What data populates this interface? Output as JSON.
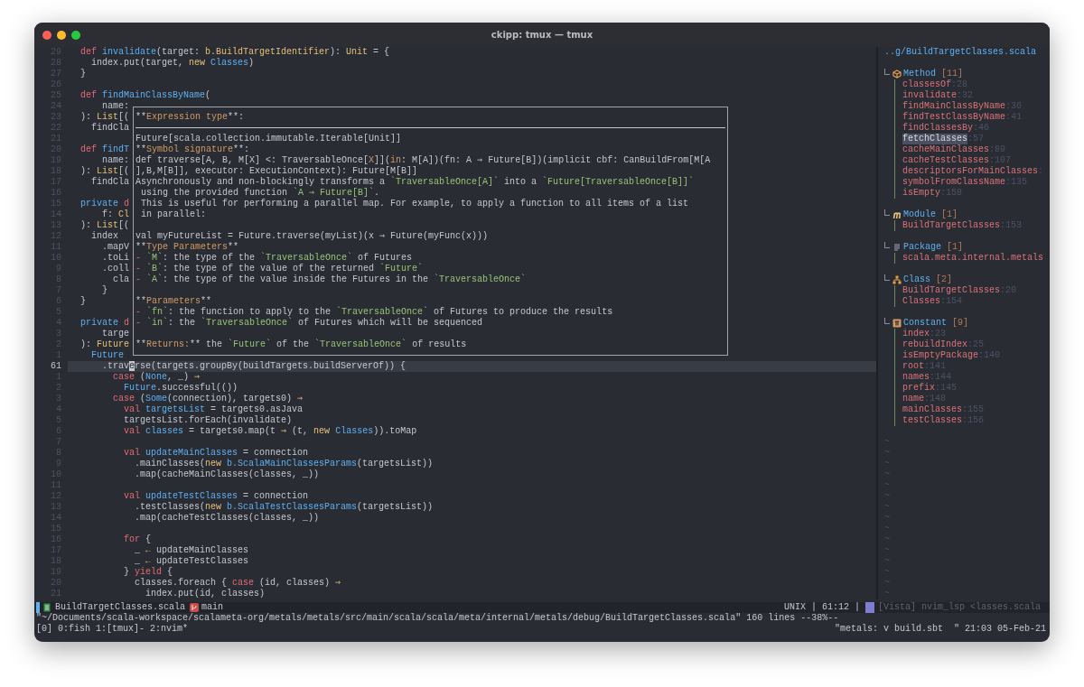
{
  "window": {
    "title": "ckipp: tmux — tmux"
  },
  "editor": {
    "lines": [
      {
        "num": "29",
        "current": false,
        "segs": [
          {
            "text": "def",
            "kind": "kw"
          },
          {
            "text": " invalidate",
            "kind": "fn"
          },
          {
            "text": "(target: ",
            "kind": "tx"
          },
          {
            "text": "b.BuildTargetIdentifier",
            "kind": "ty"
          },
          {
            "text": "): ",
            "kind": "tx"
          },
          {
            "text": "Unit",
            "kind": "ty"
          },
          {
            "text": " = {",
            "kind": "tx"
          }
        ]
      },
      {
        "num": "28",
        "current": false,
        "segs": [
          {
            "text": "  index.put(target, ",
            "kind": "tx"
          },
          {
            "text": "new",
            "kind": "ty"
          },
          {
            "text": " Classes",
            "kind": "fn"
          },
          {
            "text": ")",
            "kind": "tx"
          }
        ]
      },
      {
        "num": "27",
        "current": false,
        "segs": [
          {
            "text": "}",
            "kind": "tx"
          }
        ]
      },
      {
        "num": "26",
        "current": false
      },
      {
        "num": "25",
        "current": false,
        "segs": [
          {
            "text": "def",
            "kind": "kw"
          },
          {
            "text": " findMainClassByName",
            "kind": "fn"
          },
          {
            "text": "(",
            "kind": "tx"
          }
        ]
      },
      {
        "num": "24",
        "current": false,
        "segs": [
          {
            "text": "    name:",
            "kind": "tx"
          }
        ]
      },
      {
        "num": "23",
        "current": false,
        "segs": [
          {
            "text": "): ",
            "kind": "tx"
          },
          {
            "text": "List",
            "kind": "ty"
          },
          {
            "text": "[(",
            "kind": "tx"
          }
        ]
      },
      {
        "num": "22",
        "current": false,
        "segs": [
          {
            "text": "  findCla",
            "kind": "tx"
          }
        ]
      },
      {
        "num": "21",
        "current": false
      },
      {
        "num": "20",
        "current": false,
        "segs": [
          {
            "text": "def",
            "kind": "kw"
          },
          {
            "text": " findT",
            "kind": "fn"
          }
        ]
      },
      {
        "num": "19",
        "current": false,
        "segs": [
          {
            "text": "    name:",
            "kind": "tx"
          }
        ]
      },
      {
        "num": "18",
        "current": false,
        "segs": [
          {
            "text": "): ",
            "kind": "tx"
          },
          {
            "text": "List",
            "kind": "ty"
          },
          {
            "text": "[(",
            "kind": "tx"
          }
        ]
      },
      {
        "num": "17",
        "current": false,
        "segs": [
          {
            "text": "  findCla",
            "kind": "tx"
          }
        ]
      },
      {
        "num": "16",
        "current": false
      },
      {
        "num": "15",
        "current": false,
        "segs": [
          {
            "text": "private",
            "kind": "fn"
          },
          {
            "text": " d",
            "kind": "kw"
          }
        ]
      },
      {
        "num": "14",
        "current": false,
        "segs": [
          {
            "text": "    f: ",
            "kind": "tx"
          },
          {
            "text": "Cl",
            "kind": "ty"
          }
        ]
      },
      {
        "num": "13",
        "current": false,
        "segs": [
          {
            "text": "): ",
            "kind": "tx"
          },
          {
            "text": "List",
            "kind": "ty"
          },
          {
            "text": "[(",
            "kind": "tx"
          }
        ]
      },
      {
        "num": "12",
        "current": false,
        "segs": [
          {
            "text": "  index",
            "kind": "tx"
          }
        ]
      },
      {
        "num": "11",
        "current": false,
        "segs": [
          {
            "text": "    .mapV",
            "kind": "tx"
          }
        ]
      },
      {
        "num": "10",
        "current": false,
        "segs": [
          {
            "text": "    .toLi",
            "kind": "tx"
          }
        ]
      },
      {
        "num": "9",
        "current": false,
        "segs": [
          {
            "text": "    .coll",
            "kind": "tx"
          }
        ]
      },
      {
        "num": "8",
        "current": false,
        "segs": [
          {
            "text": "      cla",
            "kind": "tx"
          }
        ]
      },
      {
        "num": "7",
        "current": false,
        "segs": [
          {
            "text": "    }",
            "kind": "tx"
          }
        ]
      },
      {
        "num": "6",
        "current": false,
        "segs": [
          {
            "text": "}",
            "kind": "tx"
          }
        ]
      },
      {
        "num": "5",
        "current": false
      },
      {
        "num": "4",
        "current": false,
        "segs": [
          {
            "text": "private",
            "kind": "fn"
          },
          {
            "text": " d",
            "kind": "kw"
          }
        ]
      },
      {
        "num": "3",
        "current": false,
        "segs": [
          {
            "text": "    targe",
            "kind": "tx"
          }
        ]
      },
      {
        "num": "2",
        "current": false,
        "segs": [
          {
            "text": "): ",
            "kind": "tx"
          },
          {
            "text": "Future",
            "kind": "ty"
          }
        ]
      },
      {
        "num": "1",
        "current": false,
        "segs": [
          {
            "text": "  Future",
            "kind": "fn"
          }
        ]
      },
      {
        "num": "61",
        "current": true,
        "segs": [
          {
            "text": "    .trav",
            "kind": "tx"
          },
          {
            "text": "e",
            "kind": "cur"
          },
          {
            "text": "rse(targets.groupBy(buildTargets.buildServerOf)) {",
            "kind": "tx"
          }
        ]
      },
      {
        "num": "1",
        "current": false,
        "segs": [
          {
            "text": "      case",
            "kind": "kw"
          },
          {
            "text": " (",
            "kind": "tx"
          },
          {
            "text": "None",
            "kind": "fn"
          },
          {
            "text": ", _) ",
            "kind": "tx"
          },
          {
            "text": "⇒",
            "kind": "ty"
          }
        ]
      },
      {
        "num": "2",
        "current": false,
        "segs": [
          {
            "text": "        Future",
            "kind": "fn"
          },
          {
            "text": ".successful(())",
            "kind": "tx"
          }
        ]
      },
      {
        "num": "3",
        "current": false,
        "segs": [
          {
            "text": "      case",
            "kind": "kw"
          },
          {
            "text": " (",
            "kind": "tx"
          },
          {
            "text": "Some",
            "kind": "fn"
          },
          {
            "text": "(connection), targets0) ",
            "kind": "tx"
          },
          {
            "text": "⇒",
            "kind": "ty"
          }
        ]
      },
      {
        "num": "4",
        "current": false,
        "segs": [
          {
            "text": "        val",
            "kind": "kw"
          },
          {
            "text": " targetsList",
            "kind": "fn"
          },
          {
            "text": " = targets0.asJava",
            "kind": "tx"
          }
        ]
      },
      {
        "num": "5",
        "current": false,
        "segs": [
          {
            "text": "        targetsList.forEach(invalidate)",
            "kind": "tx"
          }
        ]
      },
      {
        "num": "6",
        "current": false,
        "segs": [
          {
            "text": "        val",
            "kind": "kw"
          },
          {
            "text": " classes",
            "kind": "fn"
          },
          {
            "text": " = targets0.map(t ",
            "kind": "tx"
          },
          {
            "text": "⇒",
            "kind": "ty"
          },
          {
            "text": " (t, ",
            "kind": "tx"
          },
          {
            "text": "new",
            "kind": "ty"
          },
          {
            "text": " Classes",
            "kind": "fn"
          },
          {
            "text": ")).toMap",
            "kind": "tx"
          }
        ]
      },
      {
        "num": "7",
        "current": false
      },
      {
        "num": "8",
        "current": false,
        "segs": [
          {
            "text": "        val",
            "kind": "kw"
          },
          {
            "text": " updateMainClasses",
            "kind": "fn"
          },
          {
            "text": " = connection",
            "kind": "tx"
          }
        ]
      },
      {
        "num": "9",
        "current": false,
        "segs": [
          {
            "text": "          .mainClasses(",
            "kind": "tx"
          },
          {
            "text": "new",
            "kind": "ty"
          },
          {
            "text": " b.ScalaMainClassesParams",
            "kind": "fn"
          },
          {
            "text": "(targetsList))",
            "kind": "tx"
          }
        ]
      },
      {
        "num": "10",
        "current": false,
        "segs": [
          {
            "text": "          .map(cacheMainClasses(classes, _))",
            "kind": "tx"
          }
        ]
      },
      {
        "num": "11",
        "current": false
      },
      {
        "num": "12",
        "current": false,
        "segs": [
          {
            "text": "        val",
            "kind": "kw"
          },
          {
            "text": " updateTestClasses",
            "kind": "fn"
          },
          {
            "text": " = connection",
            "kind": "tx"
          }
        ]
      },
      {
        "num": "13",
        "current": false,
        "segs": [
          {
            "text": "          .testClasses(",
            "kind": "tx"
          },
          {
            "text": "new",
            "kind": "ty"
          },
          {
            "text": " b.ScalaTestClassesParams",
            "kind": "fn"
          },
          {
            "text": "(targetsList))",
            "kind": "tx"
          }
        ]
      },
      {
        "num": "14",
        "current": false,
        "segs": [
          {
            "text": "          .map(cacheTestClasses(classes, _))",
            "kind": "tx"
          }
        ]
      },
      {
        "num": "15",
        "current": false
      },
      {
        "num": "16",
        "current": false,
        "segs": [
          {
            "text": "        for",
            "kind": "kw"
          },
          {
            "text": " {",
            "kind": "tx"
          }
        ]
      },
      {
        "num": "17",
        "current": false,
        "segs": [
          {
            "text": "          _ ",
            "kind": "tx"
          },
          {
            "text": "←",
            "kind": "ty"
          },
          {
            "text": " updateMainClasses",
            "kind": "tx"
          }
        ]
      },
      {
        "num": "18",
        "current": false,
        "segs": [
          {
            "text": "          _ ",
            "kind": "tx"
          },
          {
            "text": "←",
            "kind": "ty"
          },
          {
            "text": " updateTestClasses",
            "kind": "tx"
          }
        ]
      },
      {
        "num": "19",
        "current": false,
        "segs": [
          {
            "text": "        } ",
            "kind": "tx"
          },
          {
            "text": "yield",
            "kind": "kw"
          },
          {
            "text": " {",
            "kind": "tx"
          }
        ]
      },
      {
        "num": "20",
        "current": false,
        "segs": [
          {
            "text": "          classes.foreach { ",
            "kind": "tx"
          },
          {
            "text": "case",
            "kind": "kw"
          },
          {
            "text": " (id, classes) ",
            "kind": "tx"
          },
          {
            "text": "⇒",
            "kind": "ty"
          }
        ]
      },
      {
        "num": "21",
        "current": false,
        "segs": [
          {
            "text": "            index.put(id, classes)",
            "kind": "tx"
          }
        ]
      }
    ]
  },
  "hover_popup": {
    "lines": [
      {
        "kind": "text",
        "segs": [
          {
            "text": "**",
            "kind": "tx"
          },
          {
            "text": "Expression type",
            "kind": "md"
          },
          {
            "text": "**:",
            "kind": "tx"
          }
        ]
      },
      {
        "kind": "rule"
      },
      {
        "kind": "text",
        "segs": [
          {
            "text": "Future[scala.collection.immutable.Iterable[Unit]]",
            "kind": "tx"
          }
        ]
      },
      {
        "kind": "text",
        "segs": [
          {
            "text": "**",
            "kind": "tx"
          },
          {
            "text": "Symbol signature",
            "kind": "md"
          },
          {
            "text": "**:",
            "kind": "tx"
          }
        ]
      },
      {
        "kind": "text",
        "segs": [
          {
            "text": "def traverse[A, B, M[X] <: TraversableOnce[",
            "kind": "tx"
          },
          {
            "text": "X",
            "kind": "md"
          },
          {
            "text": "]](",
            "kind": "tx"
          },
          {
            "text": "in",
            "kind": "md"
          },
          {
            "text": ": M[A])(fn: A ⇒ Future[B])(implicit cbf: CanBuildFrom[M[A",
            "kind": "tx"
          }
        ]
      },
      {
        "kind": "text",
        "segs": [
          {
            "text": "],B,M[B]], executor: ExecutionContext): Future[M[B]]",
            "kind": "tx"
          }
        ]
      },
      {
        "kind": "text",
        "segs": [
          {
            "text": "Asynchronously and non-blockingly transforms a ",
            "kind": "tx"
          },
          {
            "text": "`TraversableOnce[A]`",
            "kind": "code"
          },
          {
            "text": " into a ",
            "kind": "tx"
          },
          {
            "text": "`Future[TraversableOnce[B]]`",
            "kind": "code"
          }
        ]
      },
      {
        "kind": "text",
        "segs": [
          {
            "text": " using the provided function ",
            "kind": "tx"
          },
          {
            "text": "`A ⇒ Future[B]`",
            "kind": "code"
          },
          {
            "text": ".",
            "kind": "tx"
          }
        ]
      },
      {
        "kind": "text",
        "segs": [
          {
            "text": " This is useful for performing a parallel map. For example, to apply a function to all items of a list",
            "kind": "tx"
          }
        ]
      },
      {
        "kind": "text",
        "segs": [
          {
            "text": " in parallel:",
            "kind": "tx"
          }
        ]
      },
      {
        "kind": "blank"
      },
      {
        "kind": "text",
        "segs": [
          {
            "text": "val myFutureList = Future.traverse(myList)(x ⇒ Future(myFunc(x)))",
            "kind": "tx"
          }
        ]
      },
      {
        "kind": "text",
        "segs": [
          {
            "text": "**",
            "kind": "tx"
          },
          {
            "text": "Type Parameters",
            "kind": "md"
          },
          {
            "text": "**",
            "kind": "tx"
          }
        ]
      },
      {
        "kind": "text",
        "segs": [
          {
            "text": "-",
            "kind": "dash"
          },
          {
            "text": " `M`",
            "kind": "code"
          },
          {
            "text": ": the type of the ",
            "kind": "tx"
          },
          {
            "text": "`TraversableOnce`",
            "kind": "code"
          },
          {
            "text": " of Futures",
            "kind": "tx"
          }
        ]
      },
      {
        "kind": "text",
        "segs": [
          {
            "text": "-",
            "kind": "dash"
          },
          {
            "text": " `B`",
            "kind": "code"
          },
          {
            "text": ": the type of the value of the returned ",
            "kind": "tx"
          },
          {
            "text": "`Future`",
            "kind": "code"
          }
        ]
      },
      {
        "kind": "text",
        "segs": [
          {
            "text": "-",
            "kind": "dash"
          },
          {
            "text": " `A`",
            "kind": "code"
          },
          {
            "text": ": the type of the value inside the Futures in the ",
            "kind": "tx"
          },
          {
            "text": "`TraversableOnce`",
            "kind": "code"
          }
        ]
      },
      {
        "kind": "blank"
      },
      {
        "kind": "text",
        "segs": [
          {
            "text": "**",
            "kind": "tx"
          },
          {
            "text": "Parameters",
            "kind": "md"
          },
          {
            "text": "**",
            "kind": "tx"
          }
        ]
      },
      {
        "kind": "text",
        "segs": [
          {
            "text": "-",
            "kind": "dash"
          },
          {
            "text": " `fn`",
            "kind": "code"
          },
          {
            "text": ": the function to apply to the ",
            "kind": "tx"
          },
          {
            "text": "`TraversableOnce`",
            "kind": "code"
          },
          {
            "text": " of Futures to produce the results",
            "kind": "tx"
          }
        ]
      },
      {
        "kind": "text",
        "segs": [
          {
            "text": "-",
            "kind": "dash"
          },
          {
            "text": " `in`",
            "kind": "code"
          },
          {
            "text": ": the ",
            "kind": "tx"
          },
          {
            "text": "`TraversableOnce`",
            "kind": "code"
          },
          {
            "text": " of Futures which will be sequenced",
            "kind": "tx"
          }
        ]
      },
      {
        "kind": "blank"
      },
      {
        "kind": "text",
        "segs": [
          {
            "text": "**",
            "kind": "tx"
          },
          {
            "text": "Returns:",
            "kind": "md"
          },
          {
            "text": "**",
            "kind": "tx"
          },
          {
            "text": " the ",
            "kind": "tx"
          },
          {
            "text": "`Future`",
            "kind": "code"
          },
          {
            "text": " of the ",
            "kind": "tx"
          },
          {
            "text": "`TraversableOnce`",
            "kind": "code"
          },
          {
            "text": " of results",
            "kind": "tx"
          }
        ]
      }
    ]
  },
  "outline": {
    "path": "..g/BuildTargetClasses.scala",
    "groups": [
      {
        "kind": "method",
        "label": "Method",
        "count": "[11]",
        "items": [
          {
            "name": "classesOf",
            "line": ":28",
            "selected": false
          },
          {
            "name": "invalidate",
            "line": ":32",
            "selected": false
          },
          {
            "name": "findMainClassByName",
            "line": ":36",
            "selected": false
          },
          {
            "name": "findTestClassByName",
            "line": ":41",
            "selected": false
          },
          {
            "name": "findClassesBy",
            "line": ":46",
            "selected": false
          },
          {
            "name": "fetchClasses",
            "line": ":57",
            "selected": true
          },
          {
            "name": "cacheMainClasses",
            "line": ":89",
            "selected": false
          },
          {
            "name": "cacheTestClasses",
            "line": ":107",
            "selected": false
          },
          {
            "name": "descriptorsForMainClasses",
            "line": ":",
            "selected": false
          },
          {
            "name": "symbolFromClassName",
            "line": ":135",
            "selected": false
          },
          {
            "name": "isEmpty",
            "line": ":158",
            "selected": false
          }
        ]
      },
      {
        "kind": "module",
        "label": "Module",
        "count": "[1]",
        "items": [
          {
            "name": "BuildTargetClasses",
            "line": ":153",
            "selected": false
          }
        ]
      },
      {
        "kind": "package",
        "label": "Package",
        "count": "[1]",
        "items": [
          {
            "name": "scala.meta.internal.metals",
            "selected": false
          }
        ]
      },
      {
        "kind": "class",
        "label": "Class",
        "count": "[2]",
        "items": [
          {
            "name": "BuildTargetClasses",
            "line": ":20",
            "selected": false
          },
          {
            "name": "Classes",
            "line": ":154",
            "selected": false
          }
        ]
      },
      {
        "kind": "constant",
        "label": "Constant",
        "count": "[9]",
        "items": [
          {
            "name": "index",
            "line": ":23",
            "selected": false
          },
          {
            "name": "rebuildIndex",
            "line": ":25",
            "selected": false
          },
          {
            "name": "isEmptyPackage",
            "line": ":140",
            "selected": false
          },
          {
            "name": "root",
            "line": ":141",
            "selected": false
          },
          {
            "name": "names",
            "line": ":144",
            "selected": false
          },
          {
            "name": "prefix",
            "line": ":145",
            "selected": false
          },
          {
            "name": "name",
            "line": ":148",
            "selected": false
          },
          {
            "name": "mainClasses",
            "line": ":155",
            "selected": false
          },
          {
            "name": "testClasses",
            "line": ":156",
            "selected": false
          }
        ]
      }
    ],
    "tildes": [
      "~",
      "~",
      "~",
      "~",
      "~",
      "~",
      "~",
      "~",
      "~",
      "~",
      "~",
      "~",
      "~",
      "~",
      "~"
    ]
  },
  "status_line": {
    "file": "BuildTargetClasses.scala",
    "branch": "main",
    "position": "UNIX | 61:12 |",
    "outline_status": "[Vista] nvim_lsp <lasses.scala"
  },
  "command_line": "\"~/Documents/scala-workspace/scalameta-org/metals/metals/src/main/scala/scala/meta/internal/metals/debug/BuildTargetClasses.scala\" 160 lines --38%--",
  "tmux": {
    "session": "[0]",
    "windows": [
      "0:fish",
      "1:[tmux]-",
      "2:nvim*"
    ],
    "status_right": "\"metals: v build.sbt  \" 21:03 05-Feb-21"
  }
}
